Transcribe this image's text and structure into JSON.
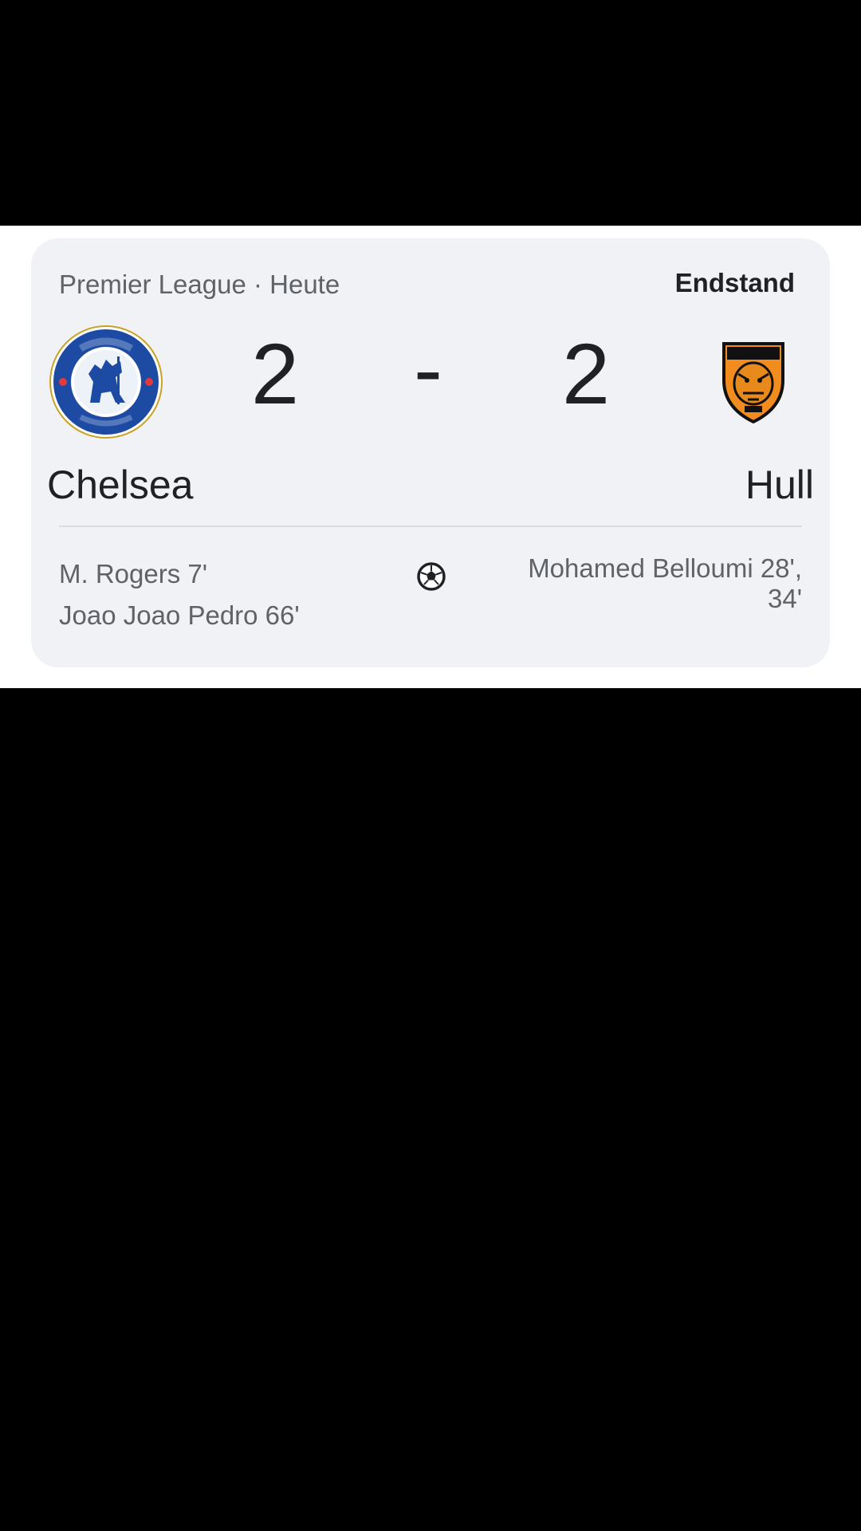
{
  "match": {
    "league_line": "Premier League · Heute",
    "status": "Endstand",
    "home": {
      "name": "Chelsea",
      "score": "2",
      "scorers": [
        "M. Rogers 7'",
        "Joao Joao Pedro 66'"
      ]
    },
    "away": {
      "name": "Hull",
      "score": "2",
      "scorers": "Mohamed Belloumi 28',\n34'"
    },
    "separator": "-"
  },
  "icons": {
    "home_crest": "chelsea-crest-icon",
    "away_crest": "hull-city-crest-icon",
    "goal": "soccer-ball-icon"
  },
  "colors": {
    "card_bg": "#f1f2f5",
    "text_primary": "#202124",
    "text_secondary": "#5f6368",
    "chelsea_blue": "#1d4ba4",
    "hull_orange": "#f28c1e"
  }
}
